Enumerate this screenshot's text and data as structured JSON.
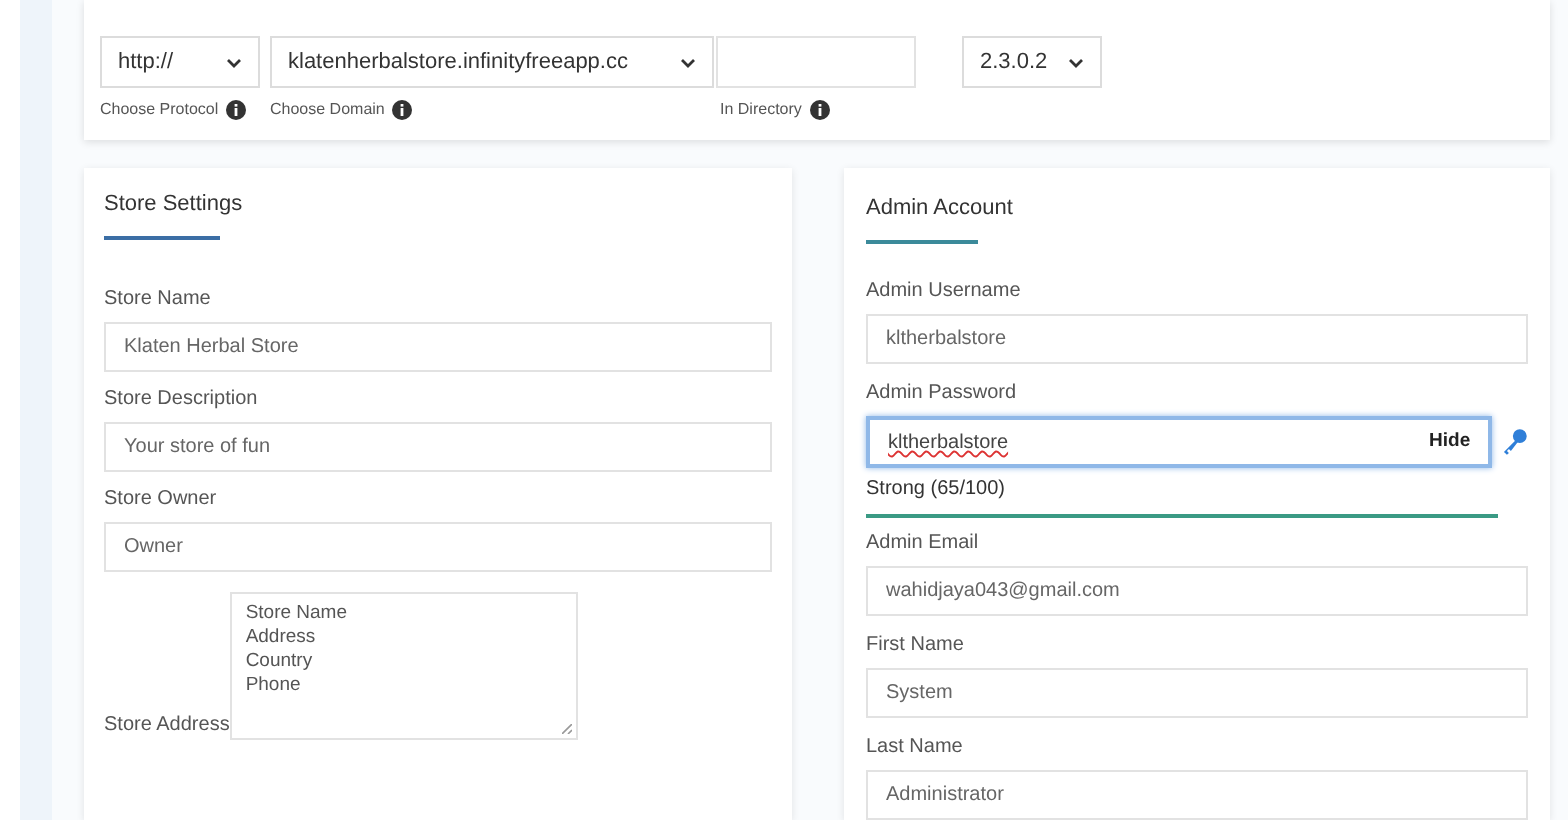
{
  "install_url": {
    "protocol": "http://",
    "domain": "klatenherbalstore.infinityfreeapp.cc",
    "version": "2.3.0.2",
    "labels": [
      "Choose Protocol",
      "Choose Domain",
      "In Directory"
    ]
  },
  "store_settings": {
    "title": "Store Settings",
    "fields": [
      {
        "label": "Store Name",
        "value": "Klaten Herbal Store"
      },
      {
        "label": "Store Description",
        "value": "Your store of fun"
      },
      {
        "label": "Store Owner",
        "value": "Owner"
      }
    ],
    "address": {
      "label": "Store Address",
      "lines": [
        "Store Name",
        "Address",
        "Country",
        "Phone"
      ]
    }
  },
  "admin_account": {
    "title": "Admin Account",
    "username": {
      "label": "Admin Username",
      "value": "kltherbalstore"
    },
    "password": {
      "label": "Admin Password",
      "value": "kltherbalstore",
      "focused": true,
      "toggle": "Hide",
      "strength": "Strong (65/100)"
    },
    "fields": [
      {
        "label": "Admin Email",
        "value": "wahidjaya043@gmail.com"
      },
      {
        "label": "First Name",
        "value": "System"
      },
      {
        "label": "Last Name",
        "value": "Administrator"
      }
    ]
  }
}
